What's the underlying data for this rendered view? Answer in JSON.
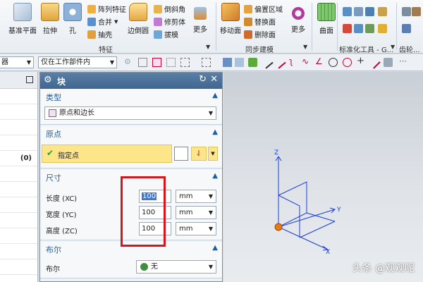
{
  "ribbon": {
    "datum_plane": "基准平面",
    "extrude": "拉伸",
    "hole": "孔",
    "pattern_feature": "阵列特征",
    "unite": "合并",
    "shell": "抽壳",
    "edge_blend": "边倒圆",
    "chamfer": "倒斜角",
    "trim_body": "修剪体",
    "draft": "拔模",
    "more1": "更多",
    "move_face": "移动面",
    "offset_region": "偏置区域",
    "replace_face": "替换面",
    "delete_face": "删除面",
    "more2": "更多",
    "surface": "曲面",
    "group_feature": "特征",
    "group_sync": "同步建模",
    "group_standard": "标准化工具 - G...",
    "group_gear": "齿轮..."
  },
  "selection_bar": {
    "filter_value": "器",
    "scope_value": "仅在工作部件内"
  },
  "navigator": {
    "row_value": "(0)"
  },
  "dialog": {
    "title": "块",
    "type_section": "类型",
    "type_value": "原点和边长",
    "origin_section": "原点",
    "specify_point": "指定点",
    "size_section": "尺寸",
    "length_label": "长度 (XC)",
    "width_label": "宽度 (YC)",
    "height_label": "高度 (ZC)",
    "length_value": "100",
    "width_value": "100",
    "height_value": "100",
    "unit": "mm",
    "boolean_section": "布尔",
    "boolean_label": "布尔",
    "boolean_value": "无"
  },
  "viewport": {
    "axis_x": "X",
    "axis_y": "Y",
    "axis_z": "Z",
    "watermark": "头条 @观观呢"
  },
  "colors": {
    "highlight": "#fde58a",
    "annotation": "#d9141c",
    "triad": "#1a3fd6",
    "origin": "#e87a12"
  }
}
